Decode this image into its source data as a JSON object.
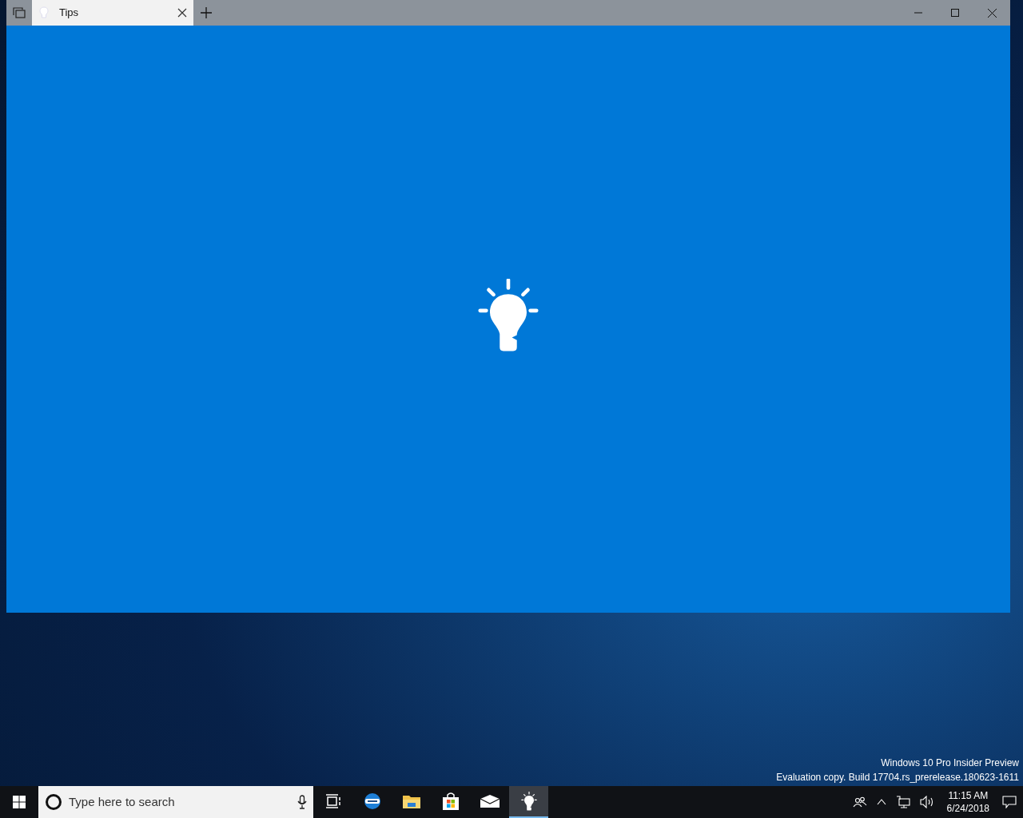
{
  "window": {
    "tabs": [
      {
        "label": "Tips",
        "selected": true
      }
    ]
  },
  "desktop": {
    "build_info": [
      "Windows 10 Pro Insider Preview",
      "Evaluation copy. Build 17704.rs_prerelease.180623-1611"
    ]
  },
  "taskbar": {
    "search": {
      "placeholder": "Type here to search"
    },
    "apps": [
      {
        "kind": "taskview",
        "selected": false
      },
      {
        "kind": "edge",
        "selected": false
      },
      {
        "kind": "explorer",
        "selected": false
      },
      {
        "kind": "store",
        "selected": false
      },
      {
        "kind": "mail",
        "selected": false
      },
      {
        "kind": "tips",
        "selected": true
      }
    ],
    "clock": {
      "time": "11:15 AM",
      "date": "6/24/2018"
    }
  }
}
